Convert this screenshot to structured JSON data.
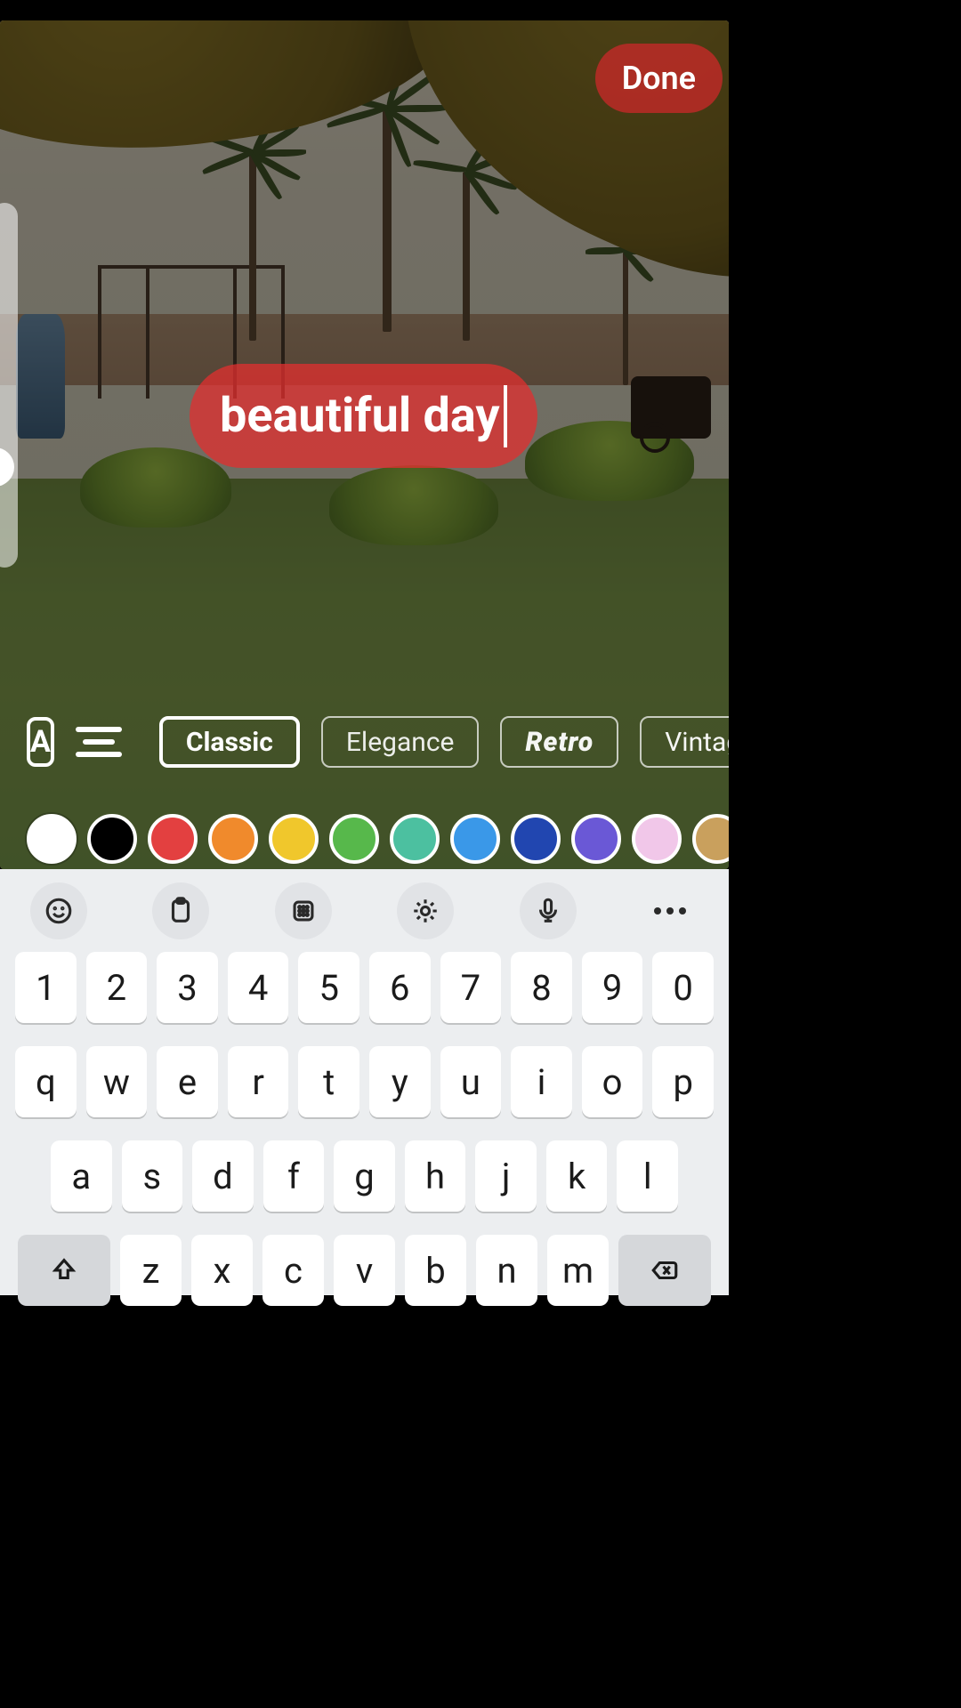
{
  "header": {
    "done_label": "Done"
  },
  "text_overlay": {
    "content": "beautiful day",
    "bg_color": "#e22f2f",
    "text_color": "#ffffff"
  },
  "font_styles": {
    "options": [
      {
        "label": "Classic",
        "selected": true
      },
      {
        "label": "Elegance",
        "selected": false
      },
      {
        "label": "Retro",
        "selected": false
      },
      {
        "label": "Vintage",
        "selected": false
      }
    ]
  },
  "colors": {
    "swatches": [
      {
        "hex": "#ffffff",
        "selected": true
      },
      {
        "hex": "#000000",
        "selected": false
      },
      {
        "hex": "#e34040",
        "selected": false
      },
      {
        "hex": "#f08a2c",
        "selected": false
      },
      {
        "hex": "#f0c72c",
        "selected": false
      },
      {
        "hex": "#57b84b",
        "selected": false
      },
      {
        "hex": "#4cc0a0",
        "selected": false
      },
      {
        "hex": "#3a98e8",
        "selected": false
      },
      {
        "hex": "#2146b0",
        "selected": false
      },
      {
        "hex": "#6a58d6",
        "selected": false
      },
      {
        "hex": "#f1c7e9",
        "selected": false
      },
      {
        "hex": "#c9a05d",
        "selected": false
      }
    ]
  },
  "keyboard": {
    "row1": [
      "1",
      "2",
      "3",
      "4",
      "5",
      "6",
      "7",
      "8",
      "9",
      "0"
    ],
    "row2": [
      "q",
      "w",
      "e",
      "r",
      "t",
      "y",
      "u",
      "i",
      "o",
      "p"
    ],
    "row3": [
      "a",
      "s",
      "d",
      "f",
      "g",
      "h",
      "j",
      "k",
      "l"
    ],
    "row4": [
      "z",
      "x",
      "c",
      "v",
      "b",
      "n",
      "m"
    ]
  }
}
